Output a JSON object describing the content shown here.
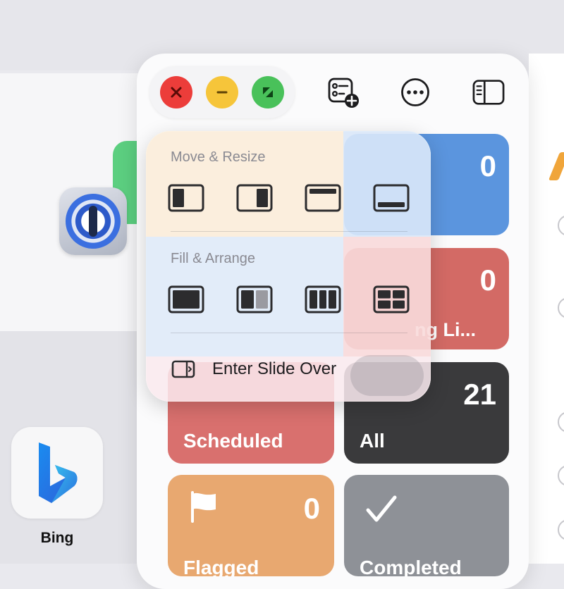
{
  "home": {
    "bing_label": "Bing"
  },
  "window": {
    "traffic": {
      "close": "✕",
      "minimize": "–",
      "zoom": "↗"
    },
    "toolbar": {
      "add_list_icon": "list-add-icon",
      "more_icon": "ellipsis-circle-icon",
      "sidebar_icon": "sidebar-icon"
    }
  },
  "lists": [
    {
      "key": "today",
      "count": "0",
      "label": ""
    },
    {
      "key": "shopping",
      "count": "0",
      "label": "ng Li..."
    },
    {
      "key": "scheduled",
      "count": "",
      "label": "Scheduled"
    },
    {
      "key": "all",
      "count": "21",
      "label": "All"
    },
    {
      "key": "flagged",
      "count": "0",
      "label": "Flagged"
    },
    {
      "key": "completed",
      "count": "",
      "label": "Completed"
    }
  ],
  "menu": {
    "move_resize_title": "Move & Resize",
    "fill_arrange_title": "Fill & Arrange",
    "slide_over_label": "Enter Slide Over"
  },
  "colors": {
    "close": "#ec3d3a",
    "minimize": "#f6c53a",
    "zoom": "#49c15a",
    "today": "#5b95de",
    "scheduled": "#d9706e",
    "all": "#3a3a3c",
    "flagged": "#e8a870",
    "completed": "#8e9197"
  }
}
